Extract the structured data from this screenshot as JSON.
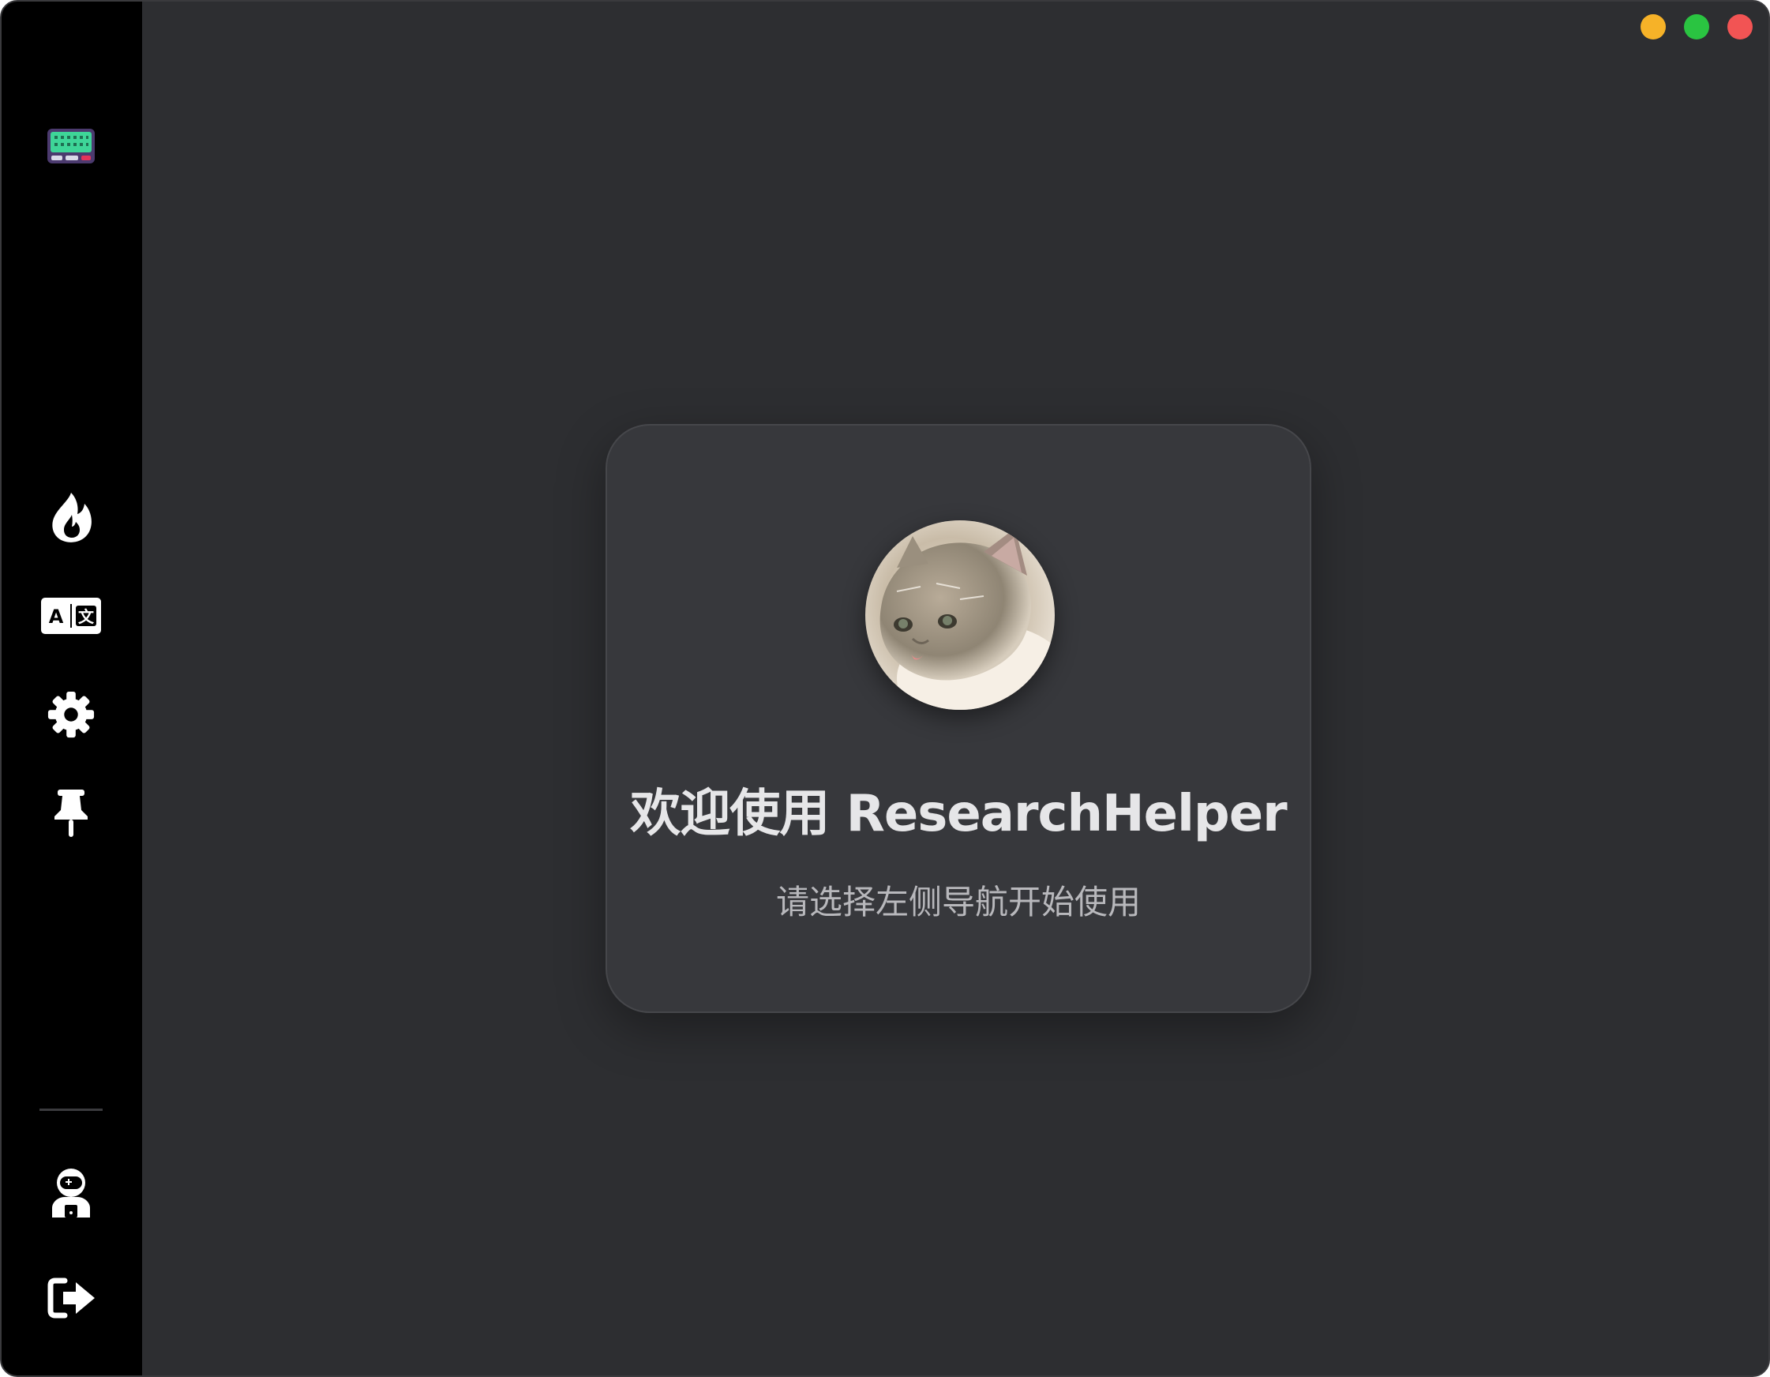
{
  "window": {
    "controls": [
      {
        "name": "minimize",
        "color": "#f6b228"
      },
      {
        "name": "maximize",
        "color": "#2ac441"
      },
      {
        "name": "close",
        "color": "#f25454"
      }
    ]
  },
  "sidebar": {
    "logo_icon": "keyboard-icon",
    "items": [
      {
        "icon": "flame-icon"
      },
      {
        "icon": "translate-icon"
      },
      {
        "icon": "gear-icon"
      },
      {
        "icon": "pushpin-icon"
      }
    ],
    "footer": [
      {
        "icon": "user-astronaut-icon"
      },
      {
        "icon": "logout-icon"
      }
    ]
  },
  "welcome": {
    "title": "欢迎使用 ResearchHelper",
    "subtitle": "请选择左侧导航开始使用",
    "avatar_icon": "cat-avatar"
  },
  "colors": {
    "background": "#2d2e31",
    "sidebar": "#000000",
    "card": "#37383c",
    "logo_accent": "#3ed598"
  }
}
